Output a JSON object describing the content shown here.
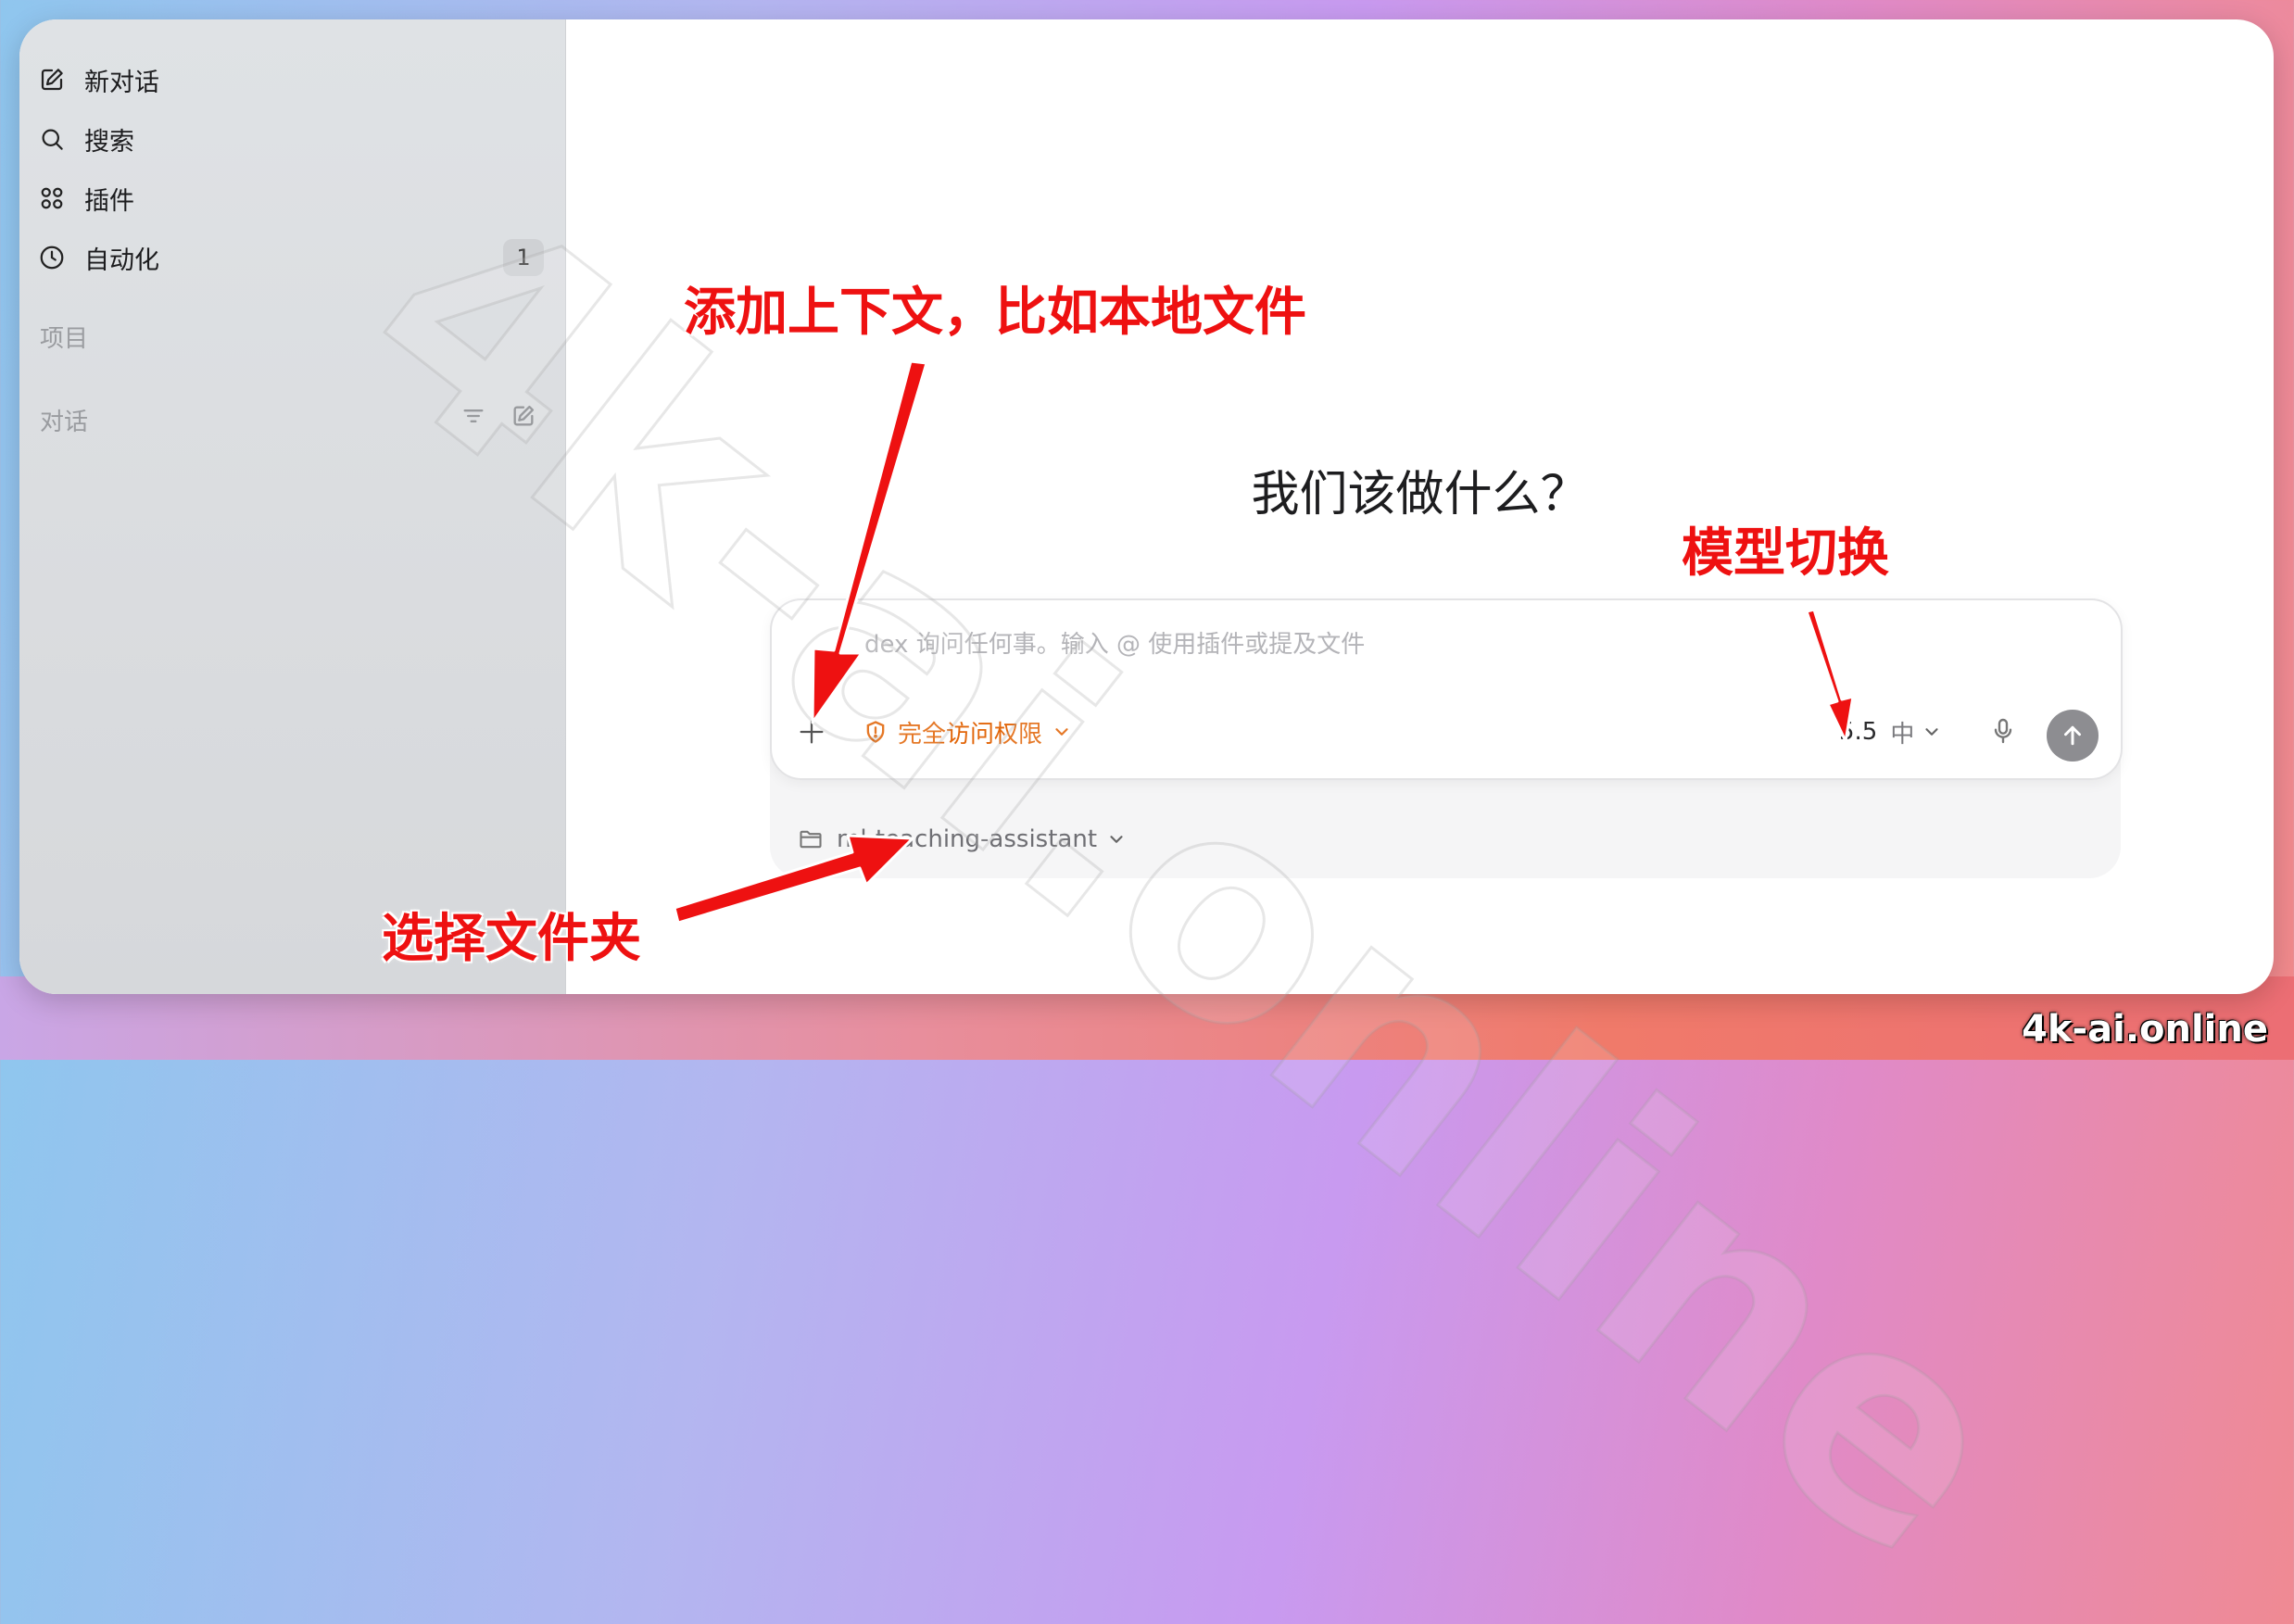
{
  "sidebar": {
    "items": [
      {
        "label": "新对话",
        "icon": "edit-icon"
      },
      {
        "label": "搜索",
        "icon": "search-icon"
      },
      {
        "label": "插件",
        "icon": "plugins-icon"
      },
      {
        "label": "自动化",
        "icon": "clock-icon",
        "badge": "1"
      }
    ],
    "projects_label": "项目",
    "conversations_label": "对话"
  },
  "main": {
    "heading": "我们该做什么？",
    "composer": {
      "placeholder_text": "dex 询问任何事。输入 @ 使用插件或提及文件",
      "access_label": "完全访问权限",
      "model_version": "5.5",
      "reasoning_level": "中"
    },
    "folder_name": "ml-teaching-assistant"
  },
  "annotations": {
    "add_context": "添加上下文，比如本地文件",
    "model_switch": "模型切换",
    "select_folder": "选择文件夹"
  },
  "watermark": "4k-ai.online",
  "corner_watermark": "4k-ai.online",
  "colors": {
    "annotation_red": "#ee1111",
    "access_orange": "#e2660a"
  }
}
